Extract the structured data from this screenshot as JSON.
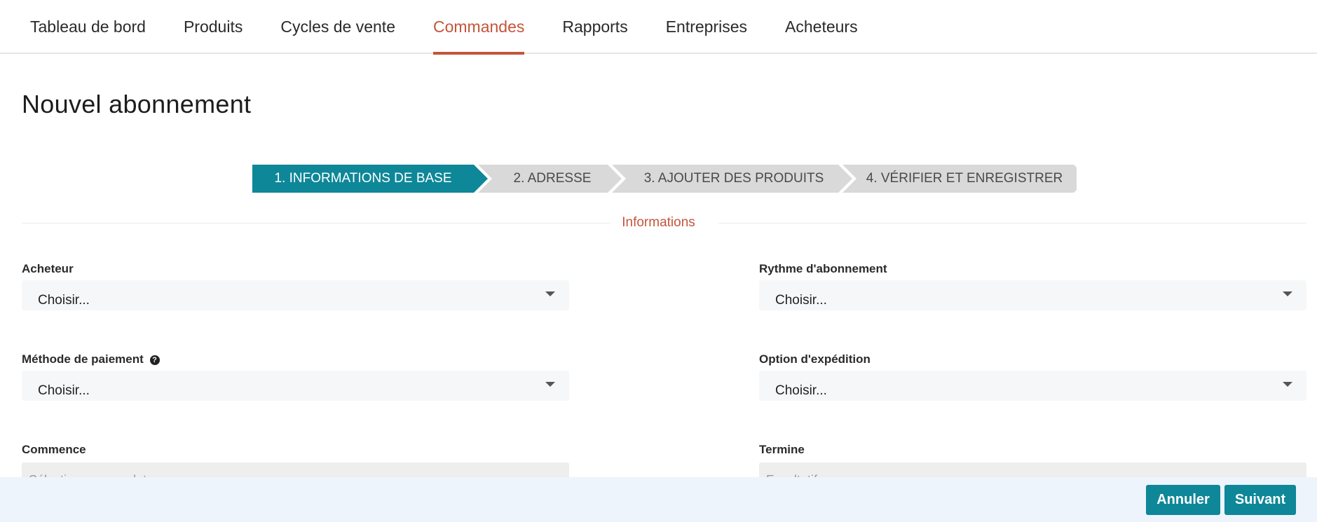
{
  "nav": {
    "items": [
      {
        "label": "Tableau de bord"
      },
      {
        "label": "Produits"
      },
      {
        "label": "Cycles de vente"
      },
      {
        "label": "Commandes"
      },
      {
        "label": "Rapports"
      },
      {
        "label": "Entreprises"
      },
      {
        "label": "Acheteurs"
      }
    ],
    "active": "Commandes"
  },
  "page": {
    "title": "Nouvel abonnement"
  },
  "stepper": {
    "steps": [
      {
        "label": "1. INFORMATIONS DE BASE",
        "state": "active"
      },
      {
        "label": "2. ADRESSE",
        "state": "inactive"
      },
      {
        "label": "3. AJOUTER DES PRODUITS",
        "state": "inactive"
      },
      {
        "label": "4. VÉRIFIER ET ENREGISTRER",
        "state": "inactive"
      }
    ]
  },
  "section": {
    "title": "Informations"
  },
  "form": {
    "buyer": {
      "label": "Acheteur",
      "value": "Choisir..."
    },
    "rhythm": {
      "label": "Rythme d'abonnement",
      "value": "Choisir..."
    },
    "payment": {
      "label": "Méthode de paiement",
      "value": "Choisir...",
      "help_icon": "question-circle-icon"
    },
    "shipping": {
      "label": "Option d'expédition",
      "value": "Choisir..."
    },
    "start": {
      "label": "Commence",
      "placeholder": "Sélectionnez une date"
    },
    "end": {
      "label": "Termine",
      "placeholder": "Facultatif"
    }
  },
  "footer": {
    "cancel_label": "Annuler",
    "next_label": "Suivant"
  },
  "colors": {
    "accent": "#0e8798",
    "active_nav": "#c4553a",
    "footer_bg": "#edf4fb"
  }
}
